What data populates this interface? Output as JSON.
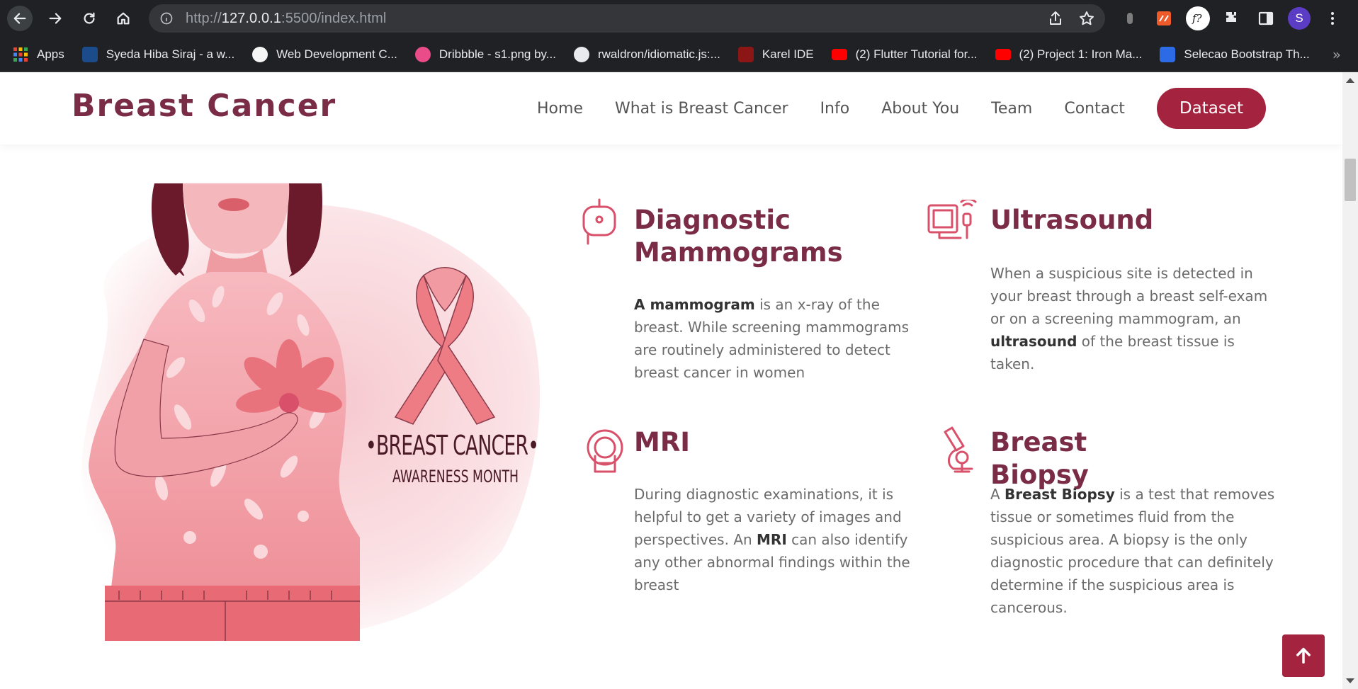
{
  "browser": {
    "url_prefix": "http://",
    "url_host": "127.0.0.1",
    "url_rest": ":5500/index.html",
    "profile_initial": "S",
    "bookmarks": [
      {
        "label": "Apps"
      },
      {
        "label": "Syeda Hiba Siraj - a w..."
      },
      {
        "label": "Web Development C..."
      },
      {
        "label": "Dribbble - s1.png by..."
      },
      {
        "label": "rwaldron/idiomatic.js:..."
      },
      {
        "label": "Karel IDE"
      },
      {
        "label": "(2) Flutter Tutorial for..."
      },
      {
        "label": "(2) Project 1: Iron Ma..."
      },
      {
        "label": "Selecao Bootstrap Th..."
      }
    ],
    "more_label": "»"
  },
  "site": {
    "logo": "Breast Cancer",
    "nav": [
      {
        "label": "Home"
      },
      {
        "label": "What is Breast Cancer"
      },
      {
        "label": "Info"
      },
      {
        "label": "About You"
      },
      {
        "label": "Team"
      },
      {
        "label": "Contact"
      }
    ],
    "cta": "Dataset"
  },
  "illustration": {
    "line1": "•BREAST CANCER•",
    "line2": "AWARENESS MONTH"
  },
  "features": {
    "mammogram": {
      "title_line1": "Diagnostic",
      "title_line2": "Mammograms",
      "bold": "A mammogram",
      "text": " is an x-ray of the breast. While screening mammograms are routinely administered to detect breast cancer in women"
    },
    "ultrasound": {
      "title": "Ultrasound",
      "text_before": "When a suspicious site is detected in your breast through a breast self-exam or on a screening mammogram, an ",
      "bold": "ultrasound",
      "text_after": " of the breast tissue is taken."
    },
    "mri": {
      "title": "MRI",
      "text_before": "During diagnostic examinations, it is helpful to get a variety of images and perspectives. An ",
      "bold": "MRI",
      "text_after": " can also identify any other abnormal findings within the breast"
    },
    "biopsy": {
      "title": "Breast Biopsy",
      "text_before": "A ",
      "bold": "Breast Biopsy",
      "text_after": " is a test that removes tissue or sometimes fluid from the suspicious area. A biopsy is the only diagnostic procedure that can definitely determine if the suspicious area is cancerous."
    }
  },
  "colors": {
    "brand": "#7a2c47",
    "accent": "#a4233f",
    "icon": "#d9506a",
    "chrome": "#202124"
  }
}
